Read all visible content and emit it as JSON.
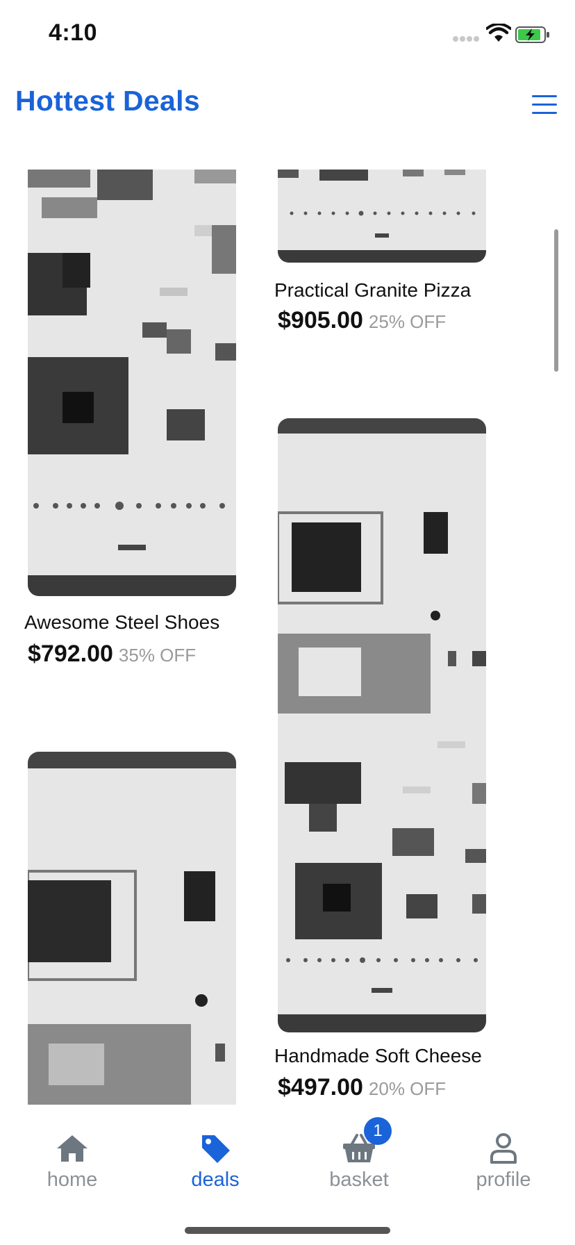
{
  "status_bar": {
    "time": "4:10"
  },
  "header": {
    "title": "Hottest Deals"
  },
  "products": [
    {
      "title": "Awesome Steel Shoes",
      "price": "$792.00",
      "discount": "35% OFF"
    },
    {
      "title": "Practical Granite Pizza",
      "price": "$905.00",
      "discount": "25% OFF"
    },
    {
      "title": "Handmade Soft Cheese",
      "price": "$497.00",
      "discount": "20% OFF"
    }
  ],
  "bottom_nav": {
    "items": [
      {
        "label": "home",
        "icon": "home-icon"
      },
      {
        "label": "deals",
        "icon": "tag-icon"
      },
      {
        "label": "basket",
        "icon": "basket-icon"
      },
      {
        "label": "profile",
        "icon": "user-icon"
      }
    ],
    "active": "deals",
    "basket_badge": "1"
  },
  "colors": {
    "accent": "#1a63d8",
    "nav_inactive": "#8b9196",
    "discount_text": "#9a9a9a"
  }
}
